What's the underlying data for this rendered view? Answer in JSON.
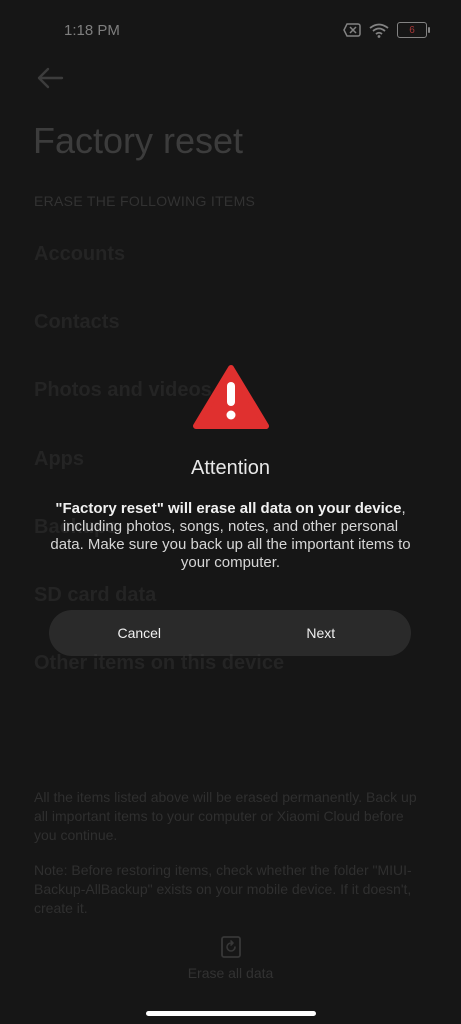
{
  "status_bar": {
    "time": "1:18 PM",
    "battery": "6"
  },
  "page": {
    "title": "Factory reset",
    "section_header": "ERASE THE FOLLOWING ITEMS",
    "items": [
      "Accounts",
      "Contacts",
      "Photos and videos",
      "Apps",
      "Backups",
      "SD card data",
      "Other items on this device"
    ],
    "note_1": "All the items listed above will be erased permanently. Back up all important items to your computer or Xiaomi Cloud before you continue.",
    "note_2": "Note: Before restoring items, check whether the folder \"MIUI-Backup-AllBackup\" exists on your mobile device. If it doesn't, create it.",
    "erase_all_label": "Erase all data"
  },
  "dialog": {
    "title": "Attention",
    "message_bold": "\"Factory reset\" will erase all data on your device",
    "message_rest": ", including photos, songs, notes, and other personal data. Make sure you back up all the important items to your computer.",
    "cancel_label": "Cancel",
    "next_label": "Next",
    "warning_color": "#e0302f"
  }
}
